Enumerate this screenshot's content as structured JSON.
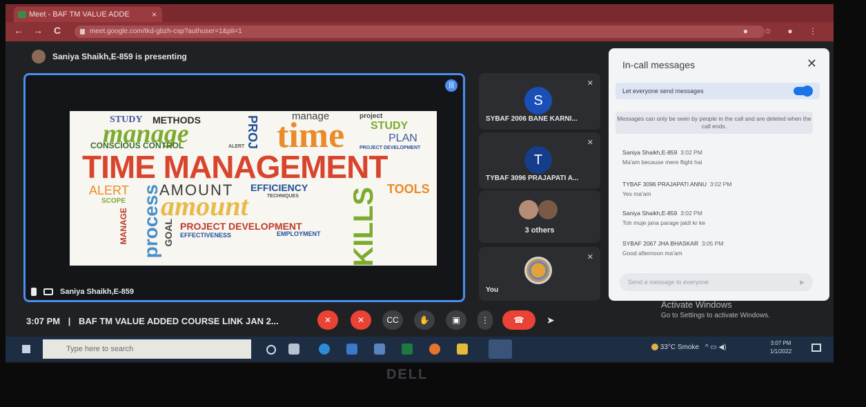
{
  "browser": {
    "tab_title": "Meet - BAF TM VALUE ADDE",
    "tab_close": "×",
    "url": "meet.google.com/tkd-gbzh-csp?authuser=1&pli=1",
    "back": "←",
    "forward": "→",
    "reload": "C"
  },
  "meet": {
    "presenting_text": "Saniya Shaikh,E-859 is presenting",
    "presenter_name": "Saniya Shaikh,E-859",
    "meeting_time": "3:07 PM",
    "separator": "|",
    "meeting_title": "BAF TM VALUE ADDED COURSE LINK JAN 2...",
    "slide_words": {
      "w1": "STUDY",
      "w2": "METHODS",
      "w3": "manage",
      "w4": "time",
      "w5": "manage",
      "w6": "project",
      "w7": "STUDY",
      "w8": "PLAN",
      "w9": "CONSCIOUS CONTROL",
      "w10": "ALERT",
      "w11": "PROJECT DEVELOPMENT",
      "w12": "TIME MANAGEMENT",
      "w13": "ALERT",
      "w14": "AMOUNT",
      "w15": "EFFICIENCY",
      "w16": "TOOLS",
      "w17": "SCOPE",
      "w18": "amount",
      "w19": "process",
      "w20": "GOAL",
      "w21": "PROJECT DEVELOPMENT",
      "w22": "EFFECTIVENESS",
      "w23": "EMPLOYMENT",
      "w24": "SKILLS",
      "w25": "MANAGE",
      "w26": "TECHNIQUES"
    },
    "participants": [
      {
        "initial": "S",
        "name": "SYBAF 2006 BANE KARNI...",
        "color": "#1a4fb8"
      },
      {
        "initial": "T",
        "name": "TYBAF 3096 PRAJAPATI A...",
        "color": "#153d8c"
      },
      {
        "name": "3 others"
      },
      {
        "name": "You"
      }
    ],
    "controls": {
      "mic": "✕",
      "cam": "✕",
      "cc": "CC",
      "hand": "✋",
      "present": "▣",
      "more": "⋮",
      "end": "☎"
    }
  },
  "chat": {
    "title": "In-call messages",
    "close": "✕",
    "toggle_label": "Let everyone send messages",
    "toggle_on": true,
    "notice": "Messages can only be seen by people in the call and are deleted when the call ends.",
    "messages": [
      {
        "sender": "Saniya Shaikh,E-859",
        "time": "3:02 PM",
        "text": "Ma'am because mere flight hai"
      },
      {
        "sender": "TYBAF 3096 PRAJAPATI ANNU",
        "time": "3:02 PM",
        "text": "Yes ma'am"
      },
      {
        "sender": "Saniya Shaikh,E-859",
        "time": "3:02 PM",
        "text": "Toh muje jana parage jaldi kr ke"
      },
      {
        "sender": "SYBAF 2067 JHA BHASKAR",
        "time": "3:05 PM",
        "text": "Good afternoon ma'am"
      }
    ],
    "input_placeholder": "Send a message to everyone"
  },
  "windows": {
    "activate_title": "Activate Windows",
    "activate_sub": "Go to Settings to activate Windows.",
    "search_placeholder": "Type here to search",
    "weather": "33°C  Smoke",
    "clock_time": "3:07 PM",
    "clock_date": "1/1/2022",
    "brand": "DELL"
  }
}
